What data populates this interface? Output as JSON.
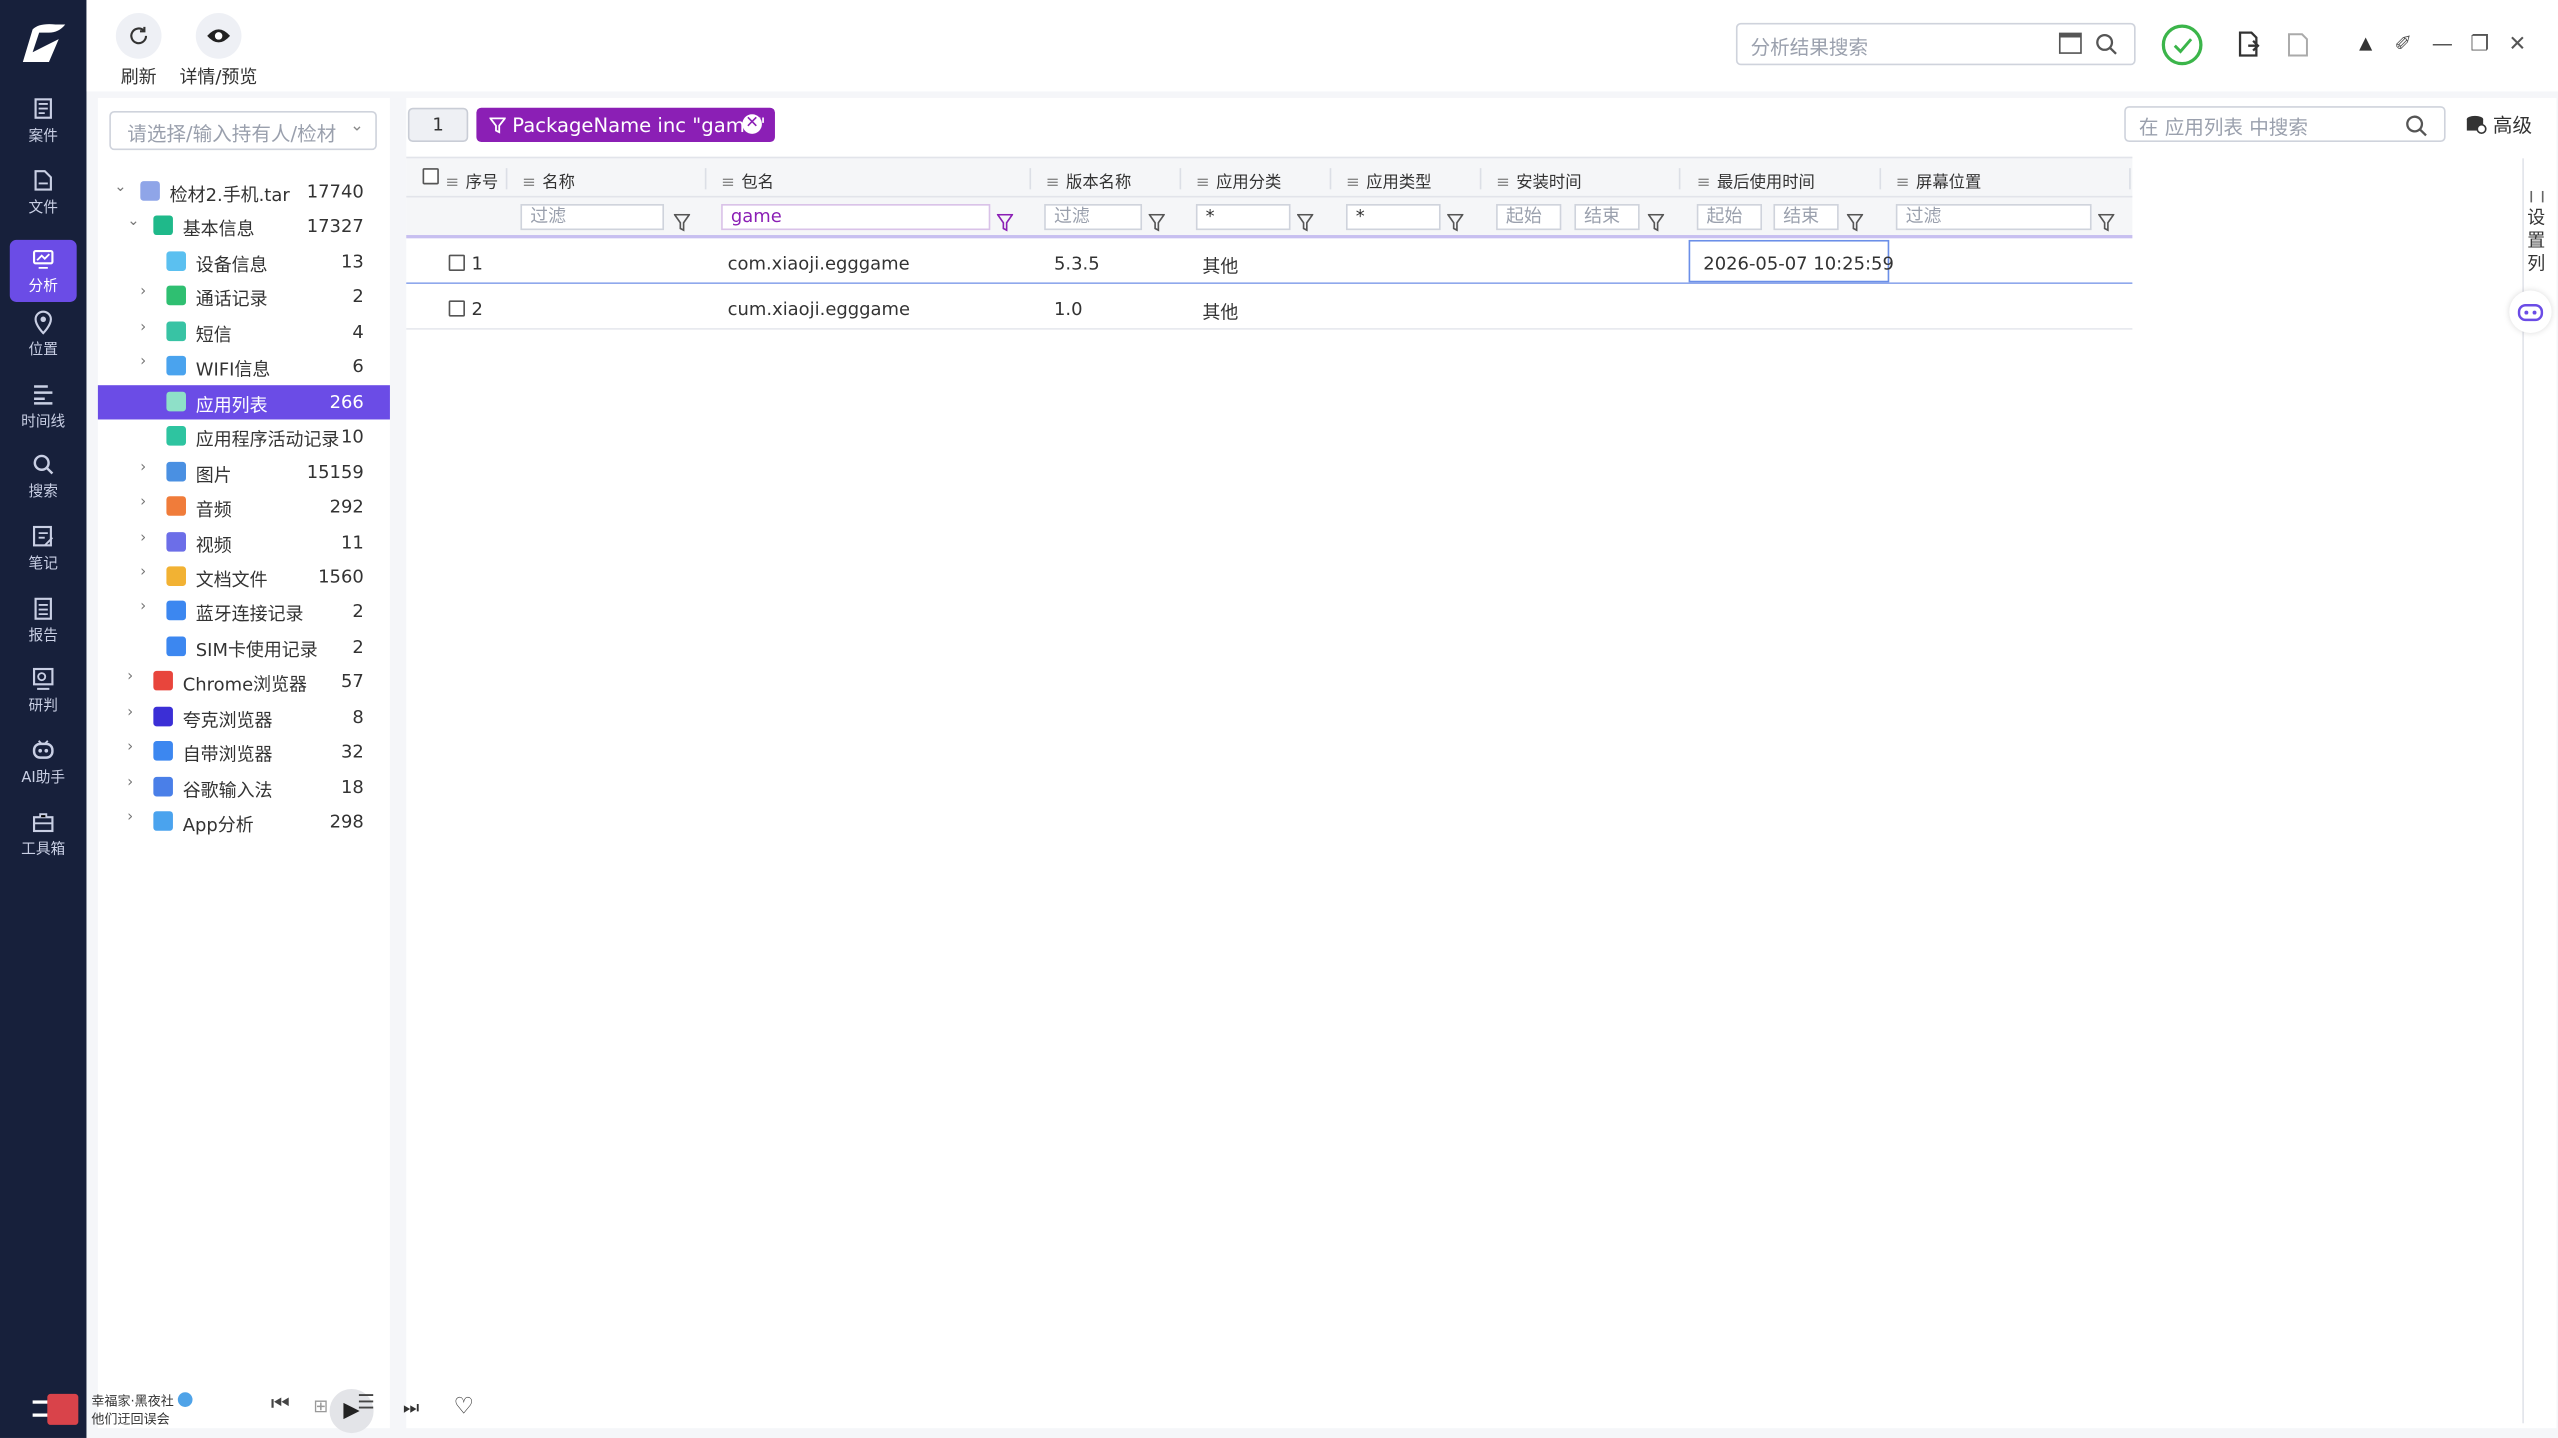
{
  "nav": {
    "items": [
      {
        "label": "案件",
        "icon": "case-icon"
      },
      {
        "label": "文件",
        "icon": "file-icon"
      },
      {
        "label": "分析",
        "icon": "analysis-icon",
        "active": true
      },
      {
        "label": "位置",
        "icon": "location-icon"
      },
      {
        "label": "时间线",
        "icon": "timeline-icon"
      },
      {
        "label": "搜索",
        "icon": "search-icon"
      },
      {
        "label": "笔记",
        "icon": "notes-icon"
      },
      {
        "label": "报告",
        "icon": "report-icon"
      },
      {
        "label": "研判",
        "icon": "judge-icon"
      },
      {
        "label": "AI助手",
        "icon": "ai-assistant-icon"
      },
      {
        "label": "工具箱",
        "icon": "toolbox-icon"
      }
    ]
  },
  "toolbar": {
    "refresh_label": "刷新",
    "preview_label": "详情/预览",
    "search_placeholder": "分析结果搜索"
  },
  "sidebar": {
    "select_placeholder": "请选择/输入持有人/检材",
    "tree": [
      {
        "label": "检材2.手机.tar",
        "count": "17740"
      },
      {
        "label": "基本信息",
        "count": "17327"
      },
      {
        "label": "设备信息",
        "count": "13"
      },
      {
        "label": "通话记录",
        "count": "2"
      },
      {
        "label": "短信",
        "count": "4"
      },
      {
        "label": "WIFI信息",
        "count": "6"
      },
      {
        "label": "应用列表",
        "count": "266"
      },
      {
        "label": "应用程序活动记录",
        "count": "10"
      },
      {
        "label": "图片",
        "count": "15159"
      },
      {
        "label": "音频",
        "count": "292"
      },
      {
        "label": "视频",
        "count": "11"
      },
      {
        "label": "文档文件",
        "count": "1560"
      },
      {
        "label": "蓝牙连接记录",
        "count": "2"
      },
      {
        "label": "SIM卡使用记录",
        "count": "2"
      },
      {
        "label": "Chrome浏览器",
        "count": "57"
      },
      {
        "label": "夸克浏览器",
        "count": "8"
      },
      {
        "label": "自带浏览器",
        "count": "32"
      },
      {
        "label": "谷歌输入法",
        "count": "18"
      },
      {
        "label": "App分析",
        "count": "298"
      }
    ]
  },
  "filter_chip": "PackageName inc \"game\"",
  "table_search_placeholder": "在 应用列表 中搜索",
  "advanced_label": "高级",
  "settings_columns_label": "设置列",
  "columns": [
    "序号",
    "名称",
    "包名",
    "版本名称",
    "应用分类",
    "应用类型",
    "安装时间",
    "最后使用时间",
    "屏幕位置"
  ],
  "filters": {
    "name": "过滤",
    "package": "game",
    "version": "过滤",
    "category": "*",
    "type": "*",
    "install_start": "起始",
    "install_end": "结束",
    "last_start": "起始",
    "last_end": "结束",
    "screen": "过滤"
  },
  "rows": [
    {
      "no": "1",
      "name": "",
      "package": "com.xiaoji.egggame",
      "version": "5.3.5",
      "category": "其他",
      "type": "",
      "install": "",
      "last_used": "2026-05-07 10:25:59",
      "screen": ""
    },
    {
      "no": "2",
      "name": "",
      "package": "cum.xiaoji.egggame",
      "version": "1.0",
      "category": "其他",
      "type": "",
      "install": "",
      "last_used": "",
      "screen": ""
    }
  ],
  "footer": {
    "line1": "幸福家·黑夜社",
    "line2": "他们迂回误会"
  },
  "colors": {
    "nav_bg": "#17203b",
    "accent": "#6b4ce6",
    "chip": "#8b1fb5"
  }
}
